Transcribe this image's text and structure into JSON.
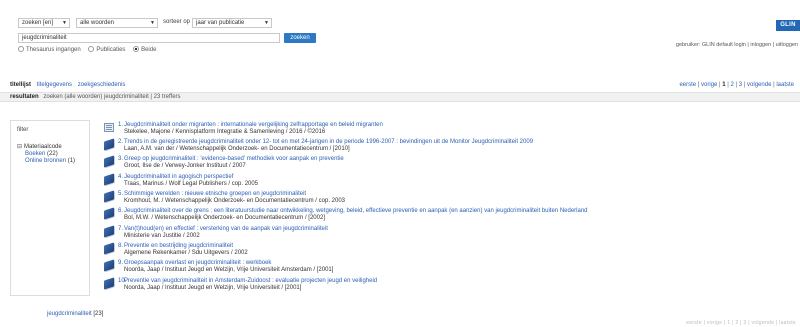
{
  "search": {
    "field_select": "zoeken [en]",
    "scope_select": "alle woorden",
    "sort_label": "sorteer op",
    "sort_select": "jaar van publicatie",
    "query": "jeugdcriminaliteit",
    "submit_label": "zoeken",
    "radio_options": [
      {
        "label": "Thesaurus ingangen",
        "selected": false
      },
      {
        "label": "Publicaties",
        "selected": false
      },
      {
        "label": "Beide",
        "selected": true
      }
    ]
  },
  "brand": {
    "logo_text": "GLIN",
    "accent": "#2368b5"
  },
  "user_line": "gebruiker: GLIN default login | inloggen | uitloggen",
  "tabs": [
    {
      "label": "titellijst",
      "active": true
    },
    {
      "label": "titelgegevens",
      "active": false
    },
    {
      "label": "zoekgeschiedenis",
      "active": false
    }
  ],
  "pager": {
    "first": "eerste",
    "prev": "vorige",
    "pages": [
      "1",
      "2",
      "3"
    ],
    "current": "1",
    "next": "volgende",
    "last": "laatste"
  },
  "results_bar": {
    "label": "resultaten",
    "query_text": "zoeken (alle woorden) jeugdcriminaliteit",
    "count_text": "23 treffers"
  },
  "filter": {
    "title": "filter",
    "facet_title": "Materiaalcode",
    "items": [
      {
        "label": "Boeken",
        "count": "(22)"
      },
      {
        "label": "Online bronnen",
        "count": "(1)"
      }
    ]
  },
  "results": [
    {
      "num": "1.",
      "icon": "web",
      "title": "Jeugdcriminaliteit onder migranten : internationale vergelijking zelfrapportage en beleid migranten",
      "sub": "Stekelee, Majone / Kennisplatform Integratie & Samenleving / 2016 / ©2016"
    },
    {
      "num": "2.",
      "icon": "book",
      "title": "Trends in de geregistreerde jeugdcriminaliteit onder 12- tot en met 24-jarigen in de periode 1996-2007 : bevindingen uit de Monitor Jeugdcriminaliteit 2009",
      "sub": "Laan, A.M. van der / Wetenschappelijk Onderzoek- en Documentatiecentrum / [2010]"
    },
    {
      "num": "3.",
      "icon": "book",
      "title": "Greep op jeugdcriminaliteit : 'evidence-based' methodiek voor aanpak en preventie",
      "sub": "Groot, Ilse de / Verwey-Jonker Instituut / 2007"
    },
    {
      "num": "4.",
      "icon": "book",
      "title": "Jeugdcriminaliteit in agogisch perspectief",
      "sub": "Traas, Marinus / Wolf Legal Publishers / cop. 2005"
    },
    {
      "num": "5.",
      "icon": "book",
      "title": "Schimmige werelden : nieuwe etnische groepen en jeugdcriminaliteit",
      "sub": "Kromhout, M. / Wetenschappelijk Onderzoek- en Documentatiecentrum / cop. 2003"
    },
    {
      "num": "6.",
      "icon": "book",
      "title": "Jeugdcriminaliteit over de grens : een literatuurstudie naar ontwikkeling, wetgeving, beleid, effectieve preventie en aanpak (en aanzien) van jeugdcriminaliteit buiten Nederland",
      "sub": "Bol, M.W. / Wetenschappelijk Onderzoek- en Documentatiecentrum / [2002]"
    },
    {
      "num": "7.",
      "icon": "book",
      "title": "Van(t)houd(en) en effectief : versterking van de aanpak van jeugdcriminaliteit",
      "sub": "Ministerie van Justitie / 2002"
    },
    {
      "num": "8.",
      "icon": "book",
      "title": "Preventie en bestrijding jeugdcriminaliteit",
      "sub": "Algemene Rekenkamer / Sdu Uitgevers / 2002"
    },
    {
      "num": "9.",
      "icon": "book",
      "title": "Groepsaanpak overlast en jeugdcriminaliteit : werkboek",
      "sub": "Noorda, Jaap / Instituut Jeugd en Welzijn, Vrije Universiteit Amsterdam / [2001]"
    },
    {
      "num": "10.",
      "icon": "book",
      "title": "Preventie van jeugdcriminaliteit in Amsterdam-Zuidoost : evaluatie projecten jeugd en veiligheid",
      "sub": "Noorda, Jaap / Instituut Jeugd en Welzijn, Vrije Universiteit / [2001]"
    }
  ],
  "bottom_link": {
    "label": "jeugdcriminaliteit",
    "count": "[23]"
  },
  "bottom_pager": "eerste | vorige | 1 | 2 | 3 | volgende | laatste"
}
